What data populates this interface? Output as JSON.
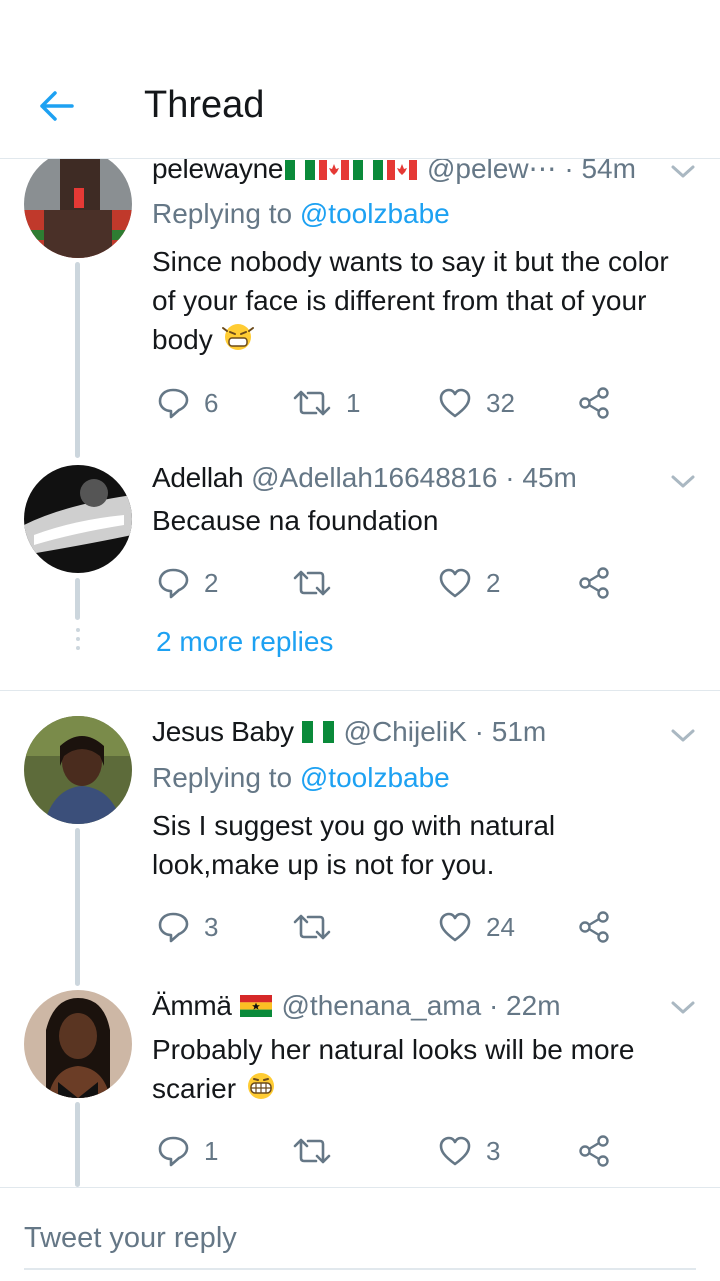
{
  "header": {
    "title": "Thread"
  },
  "tweets": [
    {
      "name": "pelewayne",
      "handle": "@pelew⋯",
      "time": " · 54m",
      "replying_prefix": "Replying to ",
      "replying_to": "@toolzbabe",
      "text": "Since nobody wants to say it but the color of your face is different from that of your body",
      "reply_count": "6",
      "retweet_count": "1",
      "like_count": "32"
    },
    {
      "name": "Adellah",
      "handle": "@Adellah16648816",
      "time": " · 45m",
      "text": "Because na foundation",
      "reply_count": "2",
      "retweet_count": "",
      "like_count": "2"
    },
    {
      "name": "Jesus Baby",
      "handle": "@ChijeliK",
      "time": " · 51m",
      "replying_prefix": "Replying to ",
      "replying_to": "@toolzbabe",
      "text": "Sis I suggest you go with natural look,make up is not for you.",
      "reply_count": "3",
      "retweet_count": "",
      "like_count": "24"
    },
    {
      "name": "Ämmä",
      "handle": "@thenana_ama",
      "time": " · 22m",
      "text": "Probably her natural looks will be more scarier",
      "reply_count": "1",
      "retweet_count": "",
      "like_count": "3"
    }
  ],
  "more_replies": "2 more replies",
  "composer": {
    "placeholder": "Tweet your reply"
  },
  "icons": [
    "back-arrow-icon",
    "reply-icon",
    "retweet-icon",
    "like-icon",
    "share-icon",
    "chevron-down-icon"
  ],
  "colors": {
    "accent": "#1da1f2",
    "secondary_text": "#657786",
    "divider": "#e1e8ed",
    "thread_line": "#ccd6dd"
  }
}
